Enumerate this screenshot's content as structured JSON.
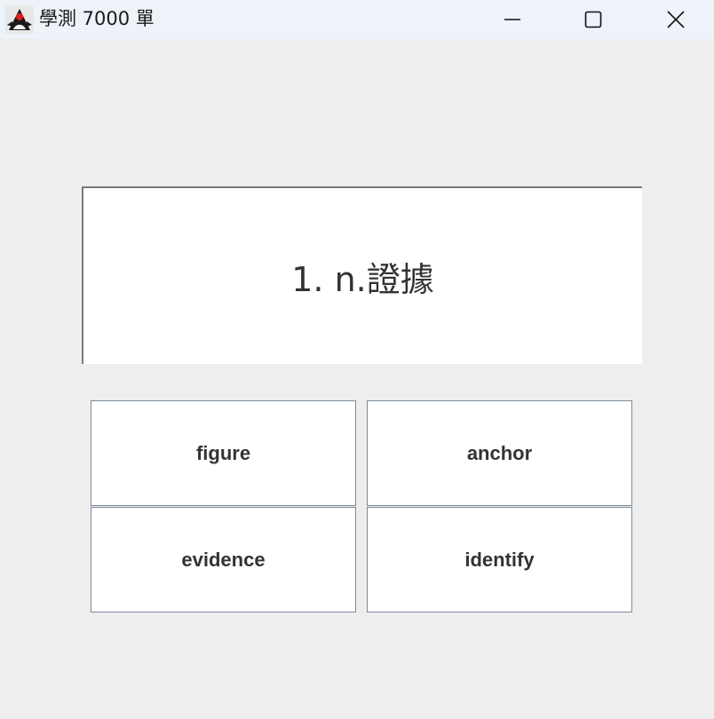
{
  "window": {
    "title": "學測 7000 單",
    "icon": "java-duke-icon"
  },
  "controls": {
    "minimize_icon": "minimize-icon",
    "maximize_icon": "maximize-icon",
    "close_icon": "close-icon"
  },
  "quiz": {
    "prompt": "1. n.證據",
    "options": [
      "figure",
      "anchor",
      "evidence",
      "identify"
    ]
  },
  "colors": {
    "background": "#eeeeee",
    "titlebar": "#eef2f9",
    "text": "#333333",
    "button_border": "#7a8a99"
  }
}
